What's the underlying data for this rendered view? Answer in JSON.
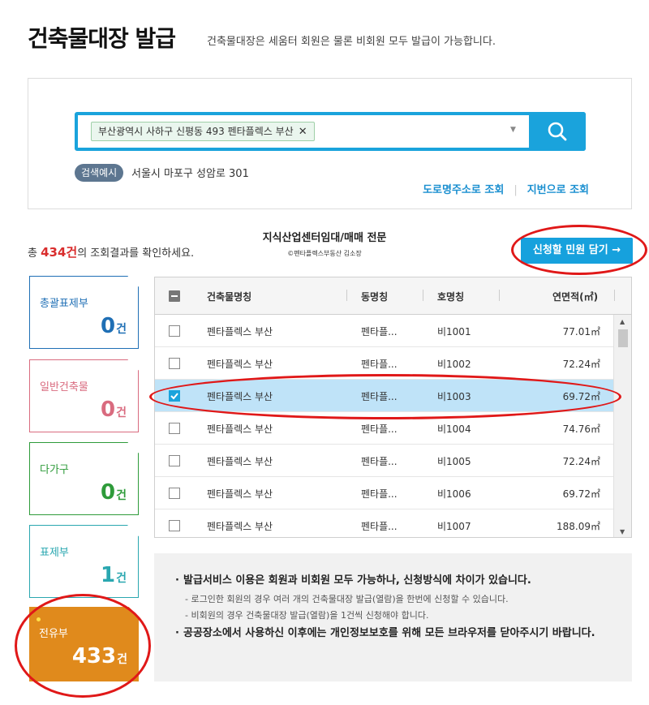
{
  "page": {
    "title": "건축물대장 발급",
    "description": "건축물대장은 세움터 회원은 물론 비회원 모두 발급이 가능합니다."
  },
  "search": {
    "tag_value": "부산광역시 사하구 신평동 493 펜타플렉스 부산",
    "close_glyph": "✕",
    "example_badge": "검색예시",
    "example_text": "서울시 마포구 성암로 301",
    "road_address_link": "도로명주소로 조회",
    "lot_number_link": "지번으로 조회"
  },
  "results": {
    "prefix": "총 ",
    "count": "434건",
    "suffix": "의 조회결과를 확인하세요."
  },
  "watermark": {
    "title": "지식산업센터임대/매매 전문",
    "sub": "©펜타플렉스부동산 김소장"
  },
  "apply_button": "신청할 민원 담기 →",
  "categories": [
    {
      "label": "총괄표제부",
      "count": "0",
      "unit": "건",
      "color": "#1f6fb5"
    },
    {
      "label": "일반건축물",
      "count": "0",
      "unit": "건",
      "color": "#d96b7f"
    },
    {
      "label": "다가구",
      "count": "0",
      "unit": "건",
      "color": "#2e9b3a"
    },
    {
      "label": "표제부",
      "count": "1",
      "unit": "건",
      "color": "#2aa7b0"
    },
    {
      "label": "전유부",
      "count": "433",
      "unit": "건",
      "color": "#e08a1c"
    }
  ],
  "table": {
    "headers": [
      "건축물명칭",
      "동명칭",
      "호명칭",
      "연면적(㎡)"
    ],
    "rows": [
      {
        "name": "펜타플렉스 부산",
        "dong": "펜타플...",
        "ho": "비1001",
        "area": "77.01㎡",
        "checked": false
      },
      {
        "name": "펜타플렉스 부산",
        "dong": "펜타플...",
        "ho": "비1002",
        "area": "72.24㎡",
        "checked": false
      },
      {
        "name": "펜타플렉스 부산",
        "dong": "펜타플...",
        "ho": "비1003",
        "area": "69.72㎡",
        "checked": true
      },
      {
        "name": "펜타플렉스 부산",
        "dong": "펜타플...",
        "ho": "비1004",
        "area": "74.76㎡",
        "checked": false
      },
      {
        "name": "펜타플렉스 부산",
        "dong": "펜타플...",
        "ho": "비1005",
        "area": "72.24㎡",
        "checked": false
      },
      {
        "name": "펜타플렉스 부산",
        "dong": "펜타플...",
        "ho": "비1006",
        "area": "69.72㎡",
        "checked": false
      },
      {
        "name": "펜타플렉스 부산",
        "dong": "펜타플...",
        "ho": "비1007",
        "area": "188.09㎡",
        "checked": false
      }
    ]
  },
  "notice": {
    "main1": "발급서비스 이용은 회원과 비회원 모두 가능하나, 신청방식에 차이가 있습니다.",
    "sub1": "- 로그인한 회원의 경우 여러 개의 건축물대장 발급(열람)을 한번에 신청할 수 있습니다.",
    "sub2": "- 비회원의 경우 건축물대장 발급(열람)을 1건씩 신청해야 합니다.",
    "main2": "공공장소에서 사용하신 이후에는 개인정보보호를 위해 모든 브라우저를 닫아주시기 바랍니다."
  },
  "annotation_color": "#e01818"
}
